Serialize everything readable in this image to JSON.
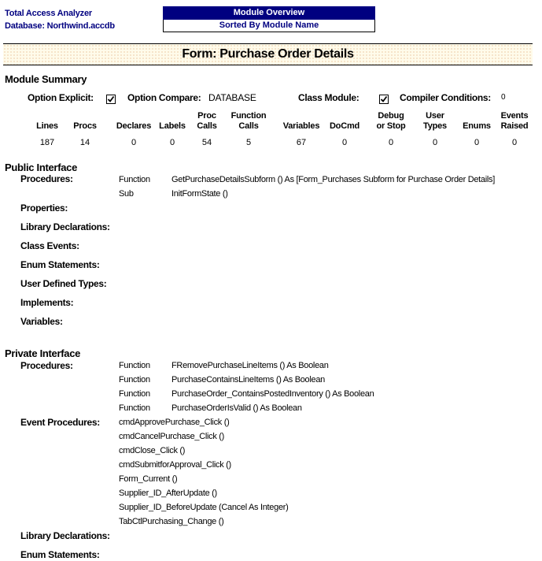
{
  "header": {
    "app_name": "Total Access Analyzer",
    "database": "Database: Northwind.accdb",
    "report_title": "Module Overview",
    "report_subtitle": "Sorted By Module Name"
  },
  "title": "Form: Purchase Order Details",
  "module_summary": {
    "heading": "Module Summary",
    "option_explicit_label": "Option Explicit:",
    "option_explicit_checked": true,
    "option_compare_label": "Option Compare:",
    "option_compare_value": "DATABASE",
    "class_module_label": "Class Module:",
    "class_module_checked": true,
    "compiler_conditions_label": "Compiler Conditions:",
    "compiler_conditions_value": "0",
    "stats": [
      {
        "line1": "",
        "line2": "Lines",
        "value": "187"
      },
      {
        "line1": "",
        "line2": "Procs",
        "value": "14"
      },
      {
        "line1": "",
        "line2": "Declares",
        "value": "0"
      },
      {
        "line1": "",
        "line2": "Labels",
        "value": "0"
      },
      {
        "line1": "Proc",
        "line2": "Calls",
        "value": "54"
      },
      {
        "line1": "Function",
        "line2": "Calls",
        "value": "5"
      },
      {
        "line1": "",
        "line2": "Variables",
        "value": "67"
      },
      {
        "line1": "",
        "line2": "DoCmd",
        "value": "0"
      },
      {
        "line1": "Debug",
        "line2": "or Stop",
        "value": "0"
      },
      {
        "line1": "User",
        "line2": "Types",
        "value": "0"
      },
      {
        "line1": "",
        "line2": "Enums",
        "value": "0"
      },
      {
        "line1": "Events",
        "line2": "Raised",
        "value": "0"
      }
    ]
  },
  "public_interface": {
    "heading": "Public Interface",
    "procedures_label": "Procedures:",
    "procedures": [
      {
        "kind": "Function",
        "signature": "GetPurchaseDetailsSubform () As [Form_Purchases Subform for Purchase Order Details]"
      },
      {
        "kind": "Sub",
        "signature": "InitFormState ()"
      }
    ],
    "labels": {
      "properties": "Properties:",
      "library_declarations": "Library Declarations:",
      "class_events": "Class Events:",
      "enum_statements": "Enum Statements:",
      "user_defined_types": "User Defined Types:",
      "implements": "Implements:",
      "variables": "Variables:"
    }
  },
  "private_interface": {
    "heading": "Private Interface",
    "procedures_label": "Procedures:",
    "procedures": [
      {
        "kind": "Function",
        "signature": "FRemovePurchaseLineItems () As Boolean"
      },
      {
        "kind": "Function",
        "signature": "PurchaseContainsLineItems () As Boolean"
      },
      {
        "kind": "Function",
        "signature": "PurchaseOrder_ContainsPostedInventory () As Boolean"
      },
      {
        "kind": "Function",
        "signature": "PurchaseOrderIsValid () As Boolean"
      }
    ],
    "event_procedures_label": "Event Procedures:",
    "event_procedures": [
      "cmdApprovePurchase_Click ()",
      "cmdCancelPurchase_Click ()",
      "cmdClose_Click ()",
      "cmdSubmitforApproval_Click ()",
      "Form_Current ()",
      "Supplier_ID_AfterUpdate ()",
      "Supplier_ID_BeforeUpdate (Cancel As Integer)",
      "TabCtlPurchasing_Change ()"
    ],
    "labels": {
      "library_declarations": "Library Declarations:",
      "enum_statements": "Enum Statements:"
    }
  },
  "colors": {
    "header_navy": "#000080",
    "title_band": "#fffbea"
  }
}
